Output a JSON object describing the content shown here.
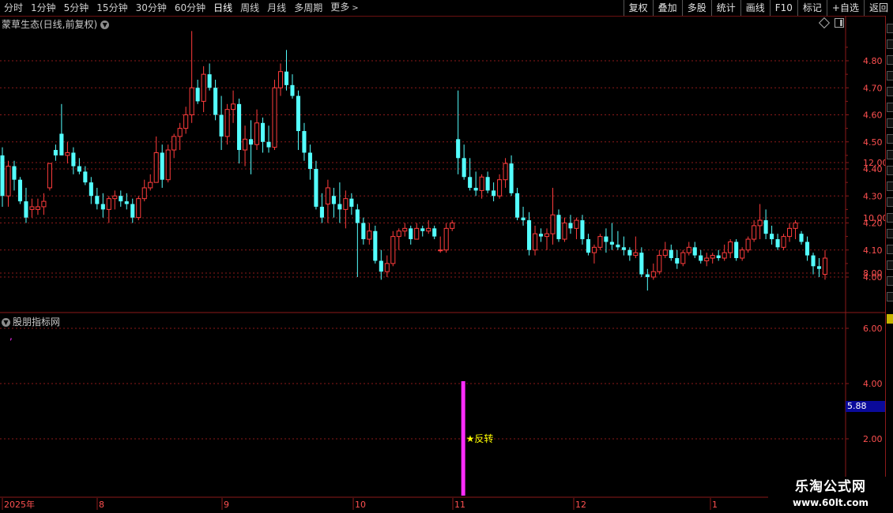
{
  "toolbar": {
    "tabs": [
      {
        "label": "分时"
      },
      {
        "label": "1分钟"
      },
      {
        "label": "5分钟"
      },
      {
        "label": "15分钟"
      },
      {
        "label": "30分钟"
      },
      {
        "label": "60分钟"
      },
      {
        "label": "日线",
        "active": true
      },
      {
        "label": "周线"
      },
      {
        "label": "月线"
      },
      {
        "label": "多周期"
      },
      {
        "label": "更多"
      }
    ],
    "tools": [
      {
        "label": "复权"
      },
      {
        "label": "叠加"
      },
      {
        "label": "多股"
      },
      {
        "label": "统计"
      },
      {
        "label": "画线"
      },
      {
        "label": "F10"
      },
      {
        "label": "标记"
      },
      {
        "label": "+自选"
      },
      {
        "label": "返回"
      }
    ]
  },
  "main_chart": {
    "title": "蒙草生态(日线,前复权)",
    "price_axis": [
      "4.80",
      "4.70",
      "4.60",
      "4.50",
      "4.40",
      "4.30",
      "4.20",
      "4.10",
      "4.00"
    ]
  },
  "indicator": {
    "title": "股朋指标网",
    "axis": [
      "12.00",
      "10.00",
      "8.00",
      "6.00",
      "4.00",
      "2.00"
    ],
    "current_value": "5.88",
    "signal_label": "★反转"
  },
  "x_axis": {
    "labels": [
      "2025年",
      "8",
      "9",
      "10",
      "11",
      "12",
      "1"
    ]
  },
  "watermark": {
    "title": "乐淘公式网",
    "url": "www.60lt.com"
  },
  "colors": {
    "up": "#ff3c3c",
    "down": "#54ffff",
    "grid": "#8b1a1a",
    "axis_text": "#ff5050",
    "signal": "#ff2cff",
    "signal_text": "#ffff00"
  },
  "chart_data": {
    "type": "candlestick",
    "title": "蒙草生态(日线,前复权)",
    "ylim": [
      3.93,
      4.93
    ],
    "ohlc": [
      [
        4.45,
        4.48,
        4.26,
        4.3
      ],
      [
        4.3,
        4.43,
        4.26,
        4.41
      ],
      [
        4.41,
        4.43,
        4.32,
        4.36
      ],
      [
        4.36,
        4.37,
        4.27,
        4.28
      ],
      [
        4.28,
        4.33,
        4.2,
        4.22
      ],
      [
        4.25,
        4.29,
        4.22,
        4.26
      ],
      [
        4.25,
        4.29,
        4.23,
        4.26
      ],
      [
        4.26,
        4.31,
        4.23,
        4.28
      ],
      [
        4.33,
        4.42,
        4.32,
        4.42
      ],
      [
        4.47,
        4.49,
        4.43,
        4.45
      ],
      [
        4.53,
        4.64,
        4.45,
        4.45
      ],
      [
        4.45,
        4.5,
        4.42,
        4.46
      ],
      [
        4.46,
        4.48,
        4.38,
        4.41
      ],
      [
        4.41,
        4.44,
        4.38,
        4.39
      ],
      [
        4.39,
        4.41,
        4.34,
        4.35
      ],
      [
        4.35,
        4.37,
        4.27,
        4.3
      ],
      [
        4.3,
        4.33,
        4.25,
        4.27
      ],
      [
        4.27,
        4.31,
        4.22,
        4.25
      ],
      [
        4.25,
        4.3,
        4.2,
        4.29
      ],
      [
        4.29,
        4.32,
        4.25,
        4.3
      ],
      [
        4.3,
        4.32,
        4.26,
        4.28
      ],
      [
        4.28,
        4.31,
        4.25,
        4.27
      ],
      [
        4.27,
        4.29,
        4.2,
        4.22
      ],
      [
        4.22,
        4.3,
        4.21,
        4.29
      ],
      [
        4.29,
        4.36,
        4.28,
        4.33
      ],
      [
        4.33,
        4.38,
        4.32,
        4.35
      ],
      [
        4.35,
        4.52,
        4.35,
        4.46
      ],
      [
        4.46,
        4.49,
        4.33,
        4.36
      ],
      [
        4.36,
        4.49,
        4.35,
        4.47
      ],
      [
        4.47,
        4.53,
        4.44,
        4.52
      ],
      [
        4.52,
        4.57,
        4.47,
        4.55
      ],
      [
        4.55,
        4.63,
        4.53,
        4.6
      ],
      [
        4.6,
        4.91,
        4.57,
        4.7
      ],
      [
        4.7,
        4.73,
        4.64,
        4.65
      ],
      [
        4.65,
        4.78,
        4.61,
        4.75
      ],
      [
        4.75,
        4.79,
        4.69,
        4.7
      ],
      [
        4.7,
        4.73,
        4.58,
        4.6
      ],
      [
        4.6,
        4.67,
        4.47,
        4.52
      ],
      [
        4.52,
        4.64,
        4.49,
        4.62
      ],
      [
        4.62,
        4.69,
        4.57,
        4.64
      ],
      [
        4.64,
        4.66,
        4.42,
        4.47
      ],
      [
        4.47,
        4.56,
        4.41,
        4.51
      ],
      [
        4.51,
        4.58,
        4.38,
        4.49
      ],
      [
        4.49,
        4.62,
        4.47,
        4.57
      ],
      [
        4.57,
        4.59,
        4.46,
        4.5
      ],
      [
        4.5,
        4.56,
        4.46,
        4.48
      ],
      [
        4.48,
        4.73,
        4.47,
        4.7
      ],
      [
        4.7,
        4.79,
        4.67,
        4.76
      ],
      [
        4.76,
        4.84,
        4.69,
        4.71
      ],
      [
        4.71,
        4.75,
        4.66,
        4.67
      ],
      [
        4.67,
        4.69,
        4.47,
        4.54
      ],
      [
        4.54,
        4.57,
        4.43,
        4.46
      ],
      [
        4.46,
        4.49,
        4.36,
        4.4
      ],
      [
        4.4,
        4.43,
        4.25,
        4.26
      ],
      [
        4.26,
        4.31,
        4.2,
        4.22
      ],
      [
        4.27,
        4.36,
        4.2,
        4.33
      ],
      [
        4.3,
        4.33,
        4.22,
        4.27
      ],
      [
        4.27,
        4.35,
        4.2,
        4.25
      ],
      [
        4.25,
        4.32,
        4.18,
        4.29
      ],
      [
        4.29,
        4.31,
        4.23,
        4.26
      ],
      [
        4.25,
        4.27,
        4.0,
        4.2
      ],
      [
        4.2,
        4.22,
        4.12,
        4.14
      ],
      [
        4.14,
        4.2,
        4.12,
        4.17
      ],
      [
        4.17,
        4.19,
        4.05,
        4.06
      ],
      [
        4.06,
        4.1,
        3.99,
        4.02
      ],
      [
        4.02,
        4.08,
        4.0,
        4.05
      ],
      [
        4.05,
        4.17,
        4.04,
        4.15
      ],
      [
        4.15,
        4.18,
        4.1,
        4.17
      ],
      [
        4.17,
        4.2,
        4.15,
        4.18
      ],
      [
        4.18,
        4.19,
        4.12,
        4.14
      ],
      [
        4.14,
        4.2,
        4.14,
        4.18
      ],
      [
        4.18,
        4.19,
        4.15,
        4.17
      ],
      [
        4.17,
        4.21,
        4.16,
        4.18
      ],
      [
        4.18,
        4.19,
        4.14,
        4.15
      ],
      [
        4.1,
        4.15,
        4.09,
        4.1
      ],
      [
        4.1,
        4.2,
        4.09,
        4.18
      ],
      [
        4.18,
        4.21,
        4.17,
        4.2
      ],
      [
        4.51,
        4.69,
        4.38,
        4.44
      ],
      [
        4.44,
        4.49,
        4.36,
        4.37
      ],
      [
        4.37,
        4.44,
        4.32,
        4.33
      ],
      [
        4.33,
        4.39,
        4.3,
        4.32
      ],
      [
        4.32,
        4.38,
        4.29,
        4.37
      ],
      [
        4.37,
        4.39,
        4.31,
        4.32
      ],
      [
        4.32,
        4.35,
        4.28,
        4.3
      ],
      [
        4.3,
        4.38,
        4.29,
        4.36
      ],
      [
        4.36,
        4.44,
        4.33,
        4.42
      ],
      [
        4.42,
        4.45,
        4.3,
        4.31
      ],
      [
        4.31,
        4.33,
        4.21,
        4.22
      ],
      [
        4.22,
        4.26,
        4.19,
        4.21
      ],
      [
        4.21,
        4.24,
        4.08,
        4.1
      ],
      [
        4.1,
        4.19,
        4.08,
        4.16
      ],
      [
        4.16,
        4.18,
        4.13,
        4.15
      ],
      [
        4.15,
        4.18,
        4.1,
        4.16
      ],
      [
        4.16,
        4.33,
        4.12,
        4.23
      ],
      [
        4.23,
        4.25,
        4.13,
        4.14
      ],
      [
        4.14,
        4.22,
        4.13,
        4.2
      ],
      [
        4.2,
        4.23,
        4.16,
        4.18
      ],
      [
        4.18,
        4.22,
        4.14,
        4.21
      ],
      [
        4.21,
        4.23,
        4.12,
        4.14
      ],
      [
        4.14,
        4.16,
        4.08,
        4.09
      ],
      [
        4.09,
        4.12,
        4.05,
        4.11
      ],
      [
        4.11,
        4.16,
        4.1,
        4.15
      ],
      [
        4.15,
        4.18,
        4.09,
        4.13
      ],
      [
        4.13,
        4.2,
        4.1,
        4.12
      ],
      [
        4.12,
        4.17,
        4.1,
        4.11
      ],
      [
        4.11,
        4.15,
        4.08,
        4.1
      ],
      [
        4.1,
        4.11,
        4.06,
        4.08
      ],
      [
        4.08,
        4.15,
        4.07,
        4.09
      ],
      [
        4.09,
        4.11,
        4.0,
        4.01
      ],
      [
        4.01,
        4.03,
        3.95,
        4.0
      ],
      [
        4.0,
        4.05,
        3.99,
        4.02
      ],
      [
        4.02,
        4.1,
        4.01,
        4.08
      ],
      [
        4.08,
        4.13,
        4.07,
        4.1
      ],
      [
        4.1,
        4.12,
        4.06,
        4.07
      ],
      [
        4.07,
        4.1,
        4.03,
        4.05
      ],
      [
        4.05,
        4.1,
        4.04,
        4.09
      ],
      [
        4.09,
        4.13,
        4.08,
        4.11
      ],
      [
        4.11,
        4.13,
        4.07,
        4.08
      ],
      [
        4.08,
        4.1,
        4.05,
        4.06
      ],
      [
        4.06,
        4.09,
        4.04,
        4.07
      ],
      [
        4.07,
        4.09,
        4.05,
        4.08
      ],
      [
        4.08,
        4.1,
        4.06,
        4.07
      ],
      [
        4.07,
        4.12,
        4.06,
        4.09
      ],
      [
        4.09,
        4.14,
        4.07,
        4.13
      ],
      [
        4.13,
        4.14,
        4.06,
        4.07
      ],
      [
        4.07,
        4.11,
        4.06,
        4.1
      ],
      [
        4.1,
        4.15,
        4.09,
        4.14
      ],
      [
        4.14,
        4.21,
        4.13,
        4.19
      ],
      [
        4.19,
        4.27,
        4.14,
        4.21
      ],
      [
        4.21,
        4.25,
        4.14,
        4.16
      ],
      [
        4.16,
        4.19,
        4.12,
        4.14
      ],
      [
        4.14,
        4.16,
        4.1,
        4.11
      ],
      [
        4.11,
        4.16,
        4.1,
        4.15
      ],
      [
        4.15,
        4.2,
        4.13,
        4.18
      ],
      [
        4.18,
        4.21,
        4.14,
        4.2
      ],
      [
        4.16,
        4.17,
        4.12,
        4.13
      ],
      [
        4.13,
        4.15,
        4.06,
        4.08
      ],
      [
        4.08,
        4.09,
        4.01,
        4.04
      ],
      [
        4.04,
        4.07,
        4.0,
        4.03
      ],
      [
        4.01,
        4.1,
        3.99,
        4.07
      ]
    ],
    "indicator_signal": {
      "index": 77,
      "value": 4.0,
      "label": "★反转"
    },
    "indicator_ylim": [
      0,
      13.2
    ],
    "x_labels": [
      "2025年",
      "8",
      "9",
      "10",
      "11",
      "12",
      "1"
    ]
  }
}
